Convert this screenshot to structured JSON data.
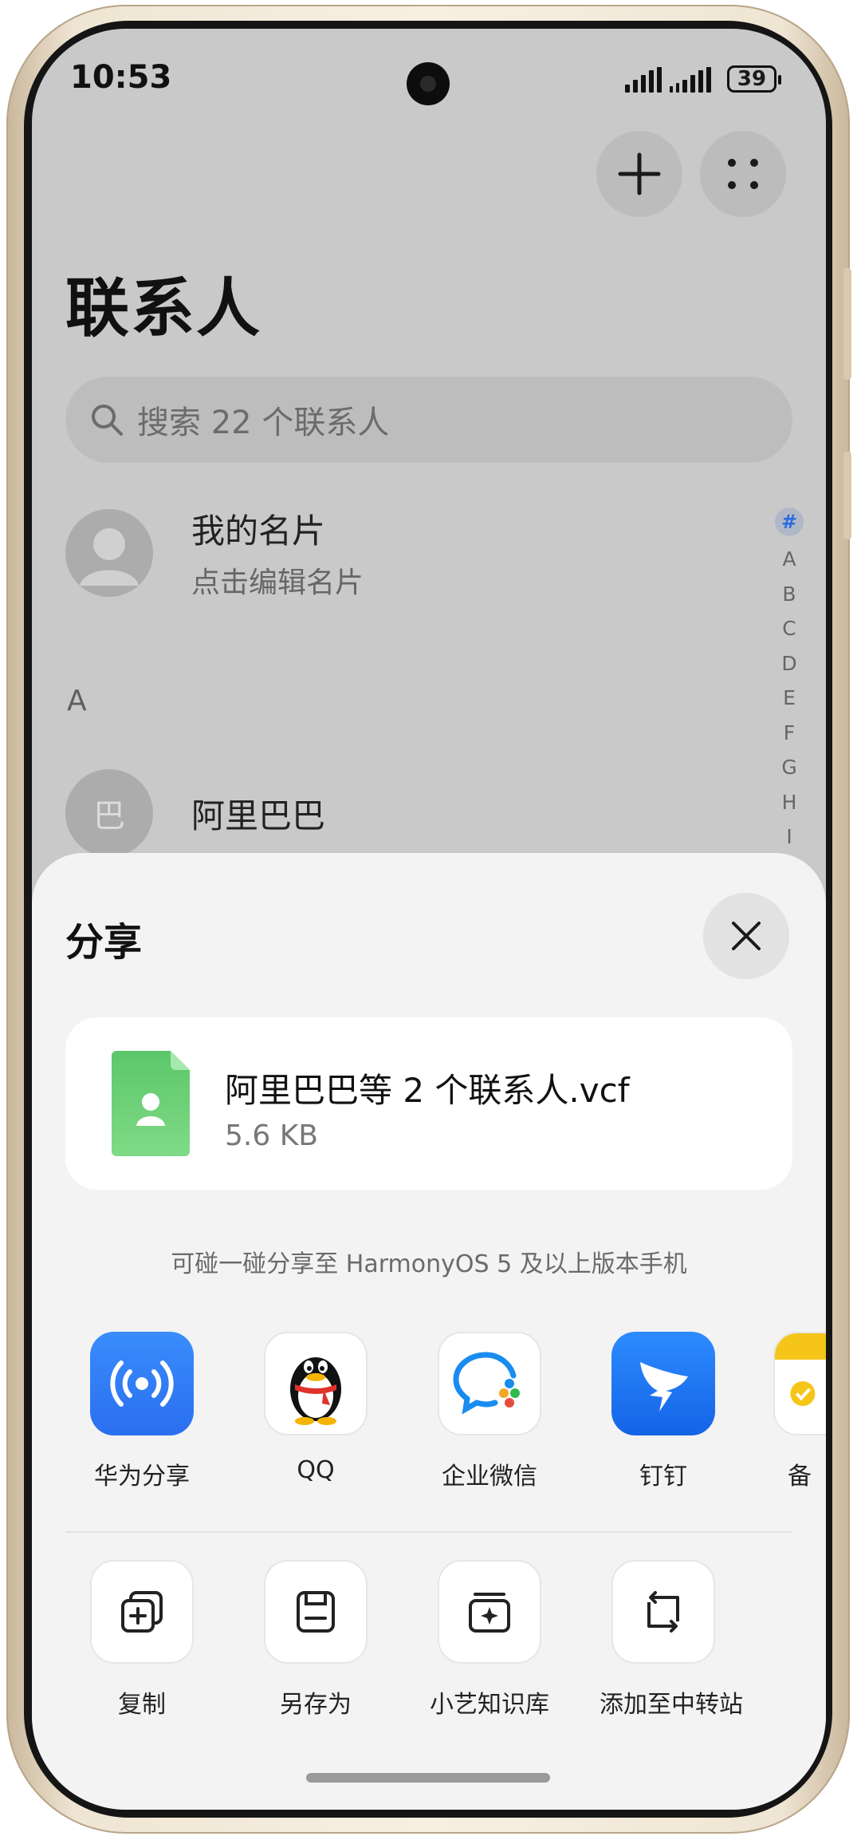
{
  "status_bar": {
    "time": "10:53",
    "battery": "39"
  },
  "header": {
    "title": "联系人"
  },
  "search": {
    "placeholder": "搜索 22 个联系人"
  },
  "my_card": {
    "title": "我的名片",
    "subtitle": "点击编辑名片"
  },
  "section_letter": "A",
  "contacts": [
    {
      "name": "阿里巴巴",
      "avatar_char": "巴"
    }
  ],
  "index_bar": [
    "#",
    "A",
    "B",
    "C",
    "D",
    "E",
    "F",
    "G",
    "H",
    "I"
  ],
  "share_sheet": {
    "title": "分享",
    "file": {
      "name": "阿里巴巴等 2 个联系人.vcf",
      "size": "5.6 KB"
    },
    "hint": "可碰一碰分享至 HarmonyOS 5 及以上版本手机",
    "apps": [
      {
        "label": "华为分享",
        "icon": "huawei-share-icon",
        "color": "#2f7cf6"
      },
      {
        "label": "QQ",
        "icon": "qq-penguin-icon",
        "color": "#ffffff"
      },
      {
        "label": "企业微信",
        "icon": "wecom-icon",
        "color": "#ffffff"
      },
      {
        "label": "钉钉",
        "icon": "dingtalk-icon",
        "color": "#1677ff"
      },
      {
        "label": "备",
        "icon": "memo-icon",
        "color": "#f5c518"
      }
    ],
    "actions": [
      {
        "label": "复制",
        "icon": "copy-icon"
      },
      {
        "label": "另存为",
        "icon": "save-as-icon"
      },
      {
        "label": "小艺知识库",
        "icon": "xiaoyi-knowledge-icon"
      },
      {
        "label": "添加至中转站",
        "icon": "transfer-station-icon"
      }
    ]
  }
}
